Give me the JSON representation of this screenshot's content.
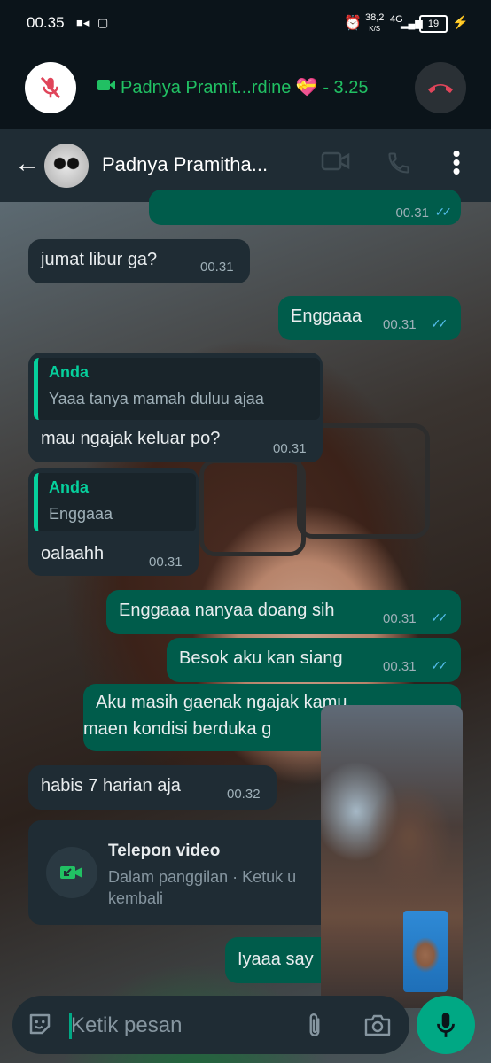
{
  "status_bar": {
    "time": "00.35",
    "net_speed": "38,2",
    "net_unit": "K/S",
    "network": "4G",
    "battery": "19"
  },
  "call_banner": {
    "text": "Padnya Pramit...rdine 💝 - 3.25",
    "accent": "#21c063"
  },
  "header": {
    "contact_name": "Padnya Pramitha..."
  },
  "messages": [
    {
      "dir": "out",
      "text": "",
      "time": "00.31"
    },
    {
      "dir": "in",
      "text": "jumat libur ga?",
      "time": "00.31"
    },
    {
      "dir": "out",
      "text": "Enggaaa",
      "time": "00.31"
    },
    {
      "dir": "in",
      "quote_author": "Anda",
      "quote_text": "Yaaa tanya mamah duluu ajaa",
      "text": "mau ngajak keluar po?",
      "time": "00.31"
    },
    {
      "dir": "in",
      "quote_author": "Anda",
      "quote_text": "Enggaaa",
      "text": "oalaahh",
      "time": "00.31"
    },
    {
      "dir": "out",
      "text": "Enggaaa nanyaa doang sih",
      "time": "00.31"
    },
    {
      "dir": "out",
      "text": "Besok aku kan siang",
      "time": "00.31"
    },
    {
      "dir": "out",
      "text_line1": "Aku masih gaenak ngajak kamu",
      "text_line2": "maen kondisi berduka g"
    },
    {
      "dir": "in",
      "text": "habis 7 harian aja",
      "time": "00.32"
    },
    {
      "dir": "in",
      "type": "video_call",
      "title": "Telepon video",
      "line1": "Dalam panggilan · Ketuk u",
      "line2": "kembali"
    },
    {
      "dir": "out",
      "text": "Iyaaa say"
    }
  ],
  "input": {
    "placeholder": "Ketik pesan"
  },
  "colors": {
    "incoming": "#1f2c34",
    "outgoing": "#005c4b",
    "read_ticks": "#53bdeb",
    "accent": "#00a884"
  }
}
